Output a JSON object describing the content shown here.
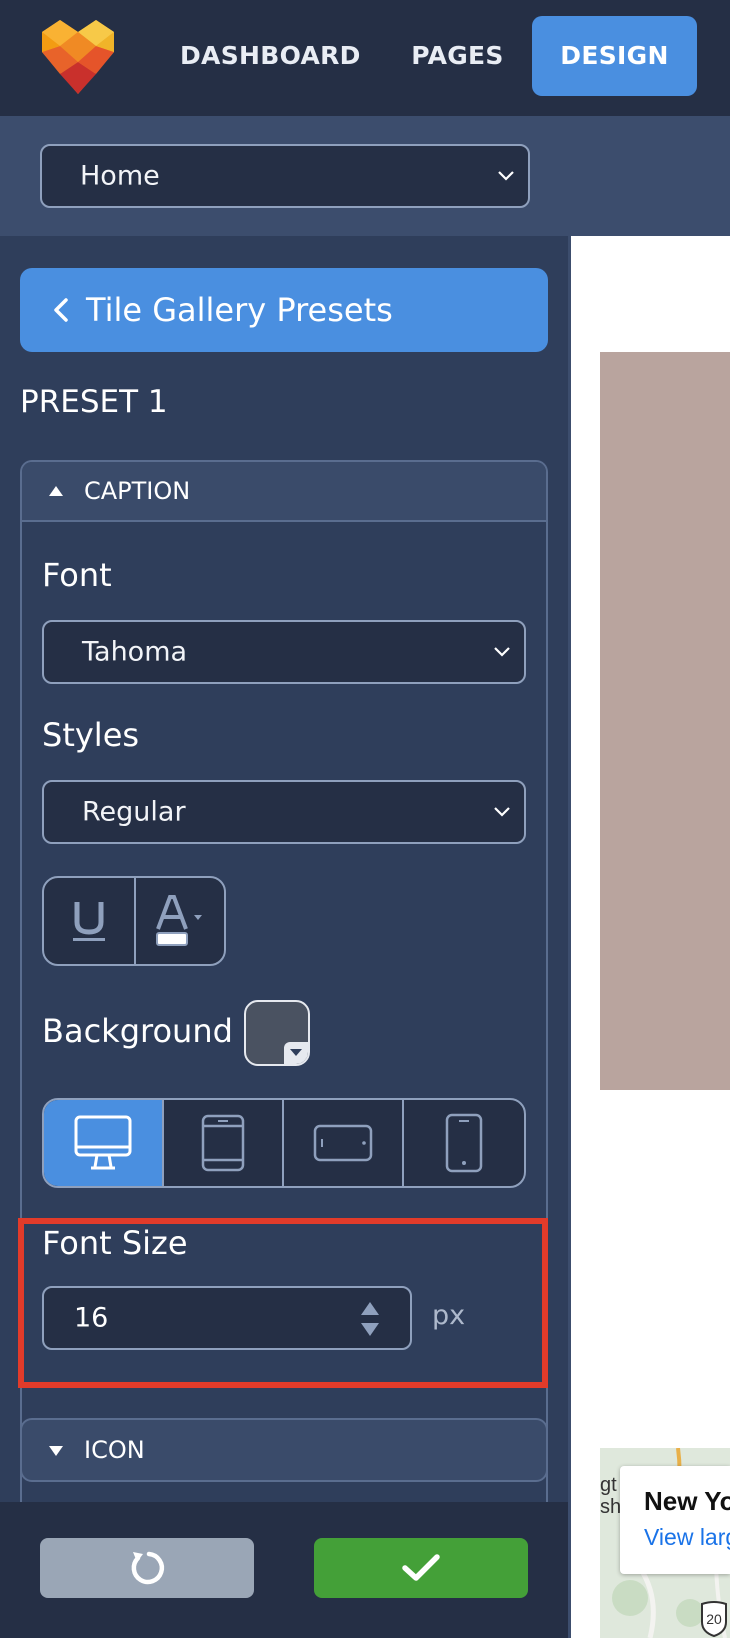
{
  "nav": {
    "items": [
      {
        "label": "DASHBOARD"
      },
      {
        "label": "PAGES"
      },
      {
        "label": "DESIGN",
        "active": true
      }
    ],
    "accent": "#4a8fe0"
  },
  "page_select": {
    "value": "Home"
  },
  "panel": {
    "back_label": "Tile Gallery Presets",
    "preset_title": "PRESET 1",
    "caption_section": {
      "title": "CAPTION",
      "font_label": "Font",
      "font_value": "Tahoma",
      "styles_label": "Styles",
      "styles_value": "Regular",
      "background_label": "Background",
      "devices": [
        "desktop-icon",
        "tablet-icon",
        "tablet-landscape-icon",
        "phone-icon"
      ],
      "active_device": "desktop-icon",
      "font_size_label": "Font Size",
      "font_size_value": "16",
      "font_size_unit": "px"
    },
    "icon_section": {
      "title": "ICON"
    }
  },
  "footer": {
    "reset_icon": "reset-icon",
    "apply_icon": "check-icon"
  },
  "preview": {
    "map_title": "New Yo",
    "map_link": "View larg",
    "map_edge_text": "gt shi",
    "route_label": "20"
  },
  "colors": {
    "panel_bg": "#2f3e5b",
    "nav_bg": "#252f45",
    "apply_green": "#44a038",
    "highlight_red": "#e23b2a"
  }
}
